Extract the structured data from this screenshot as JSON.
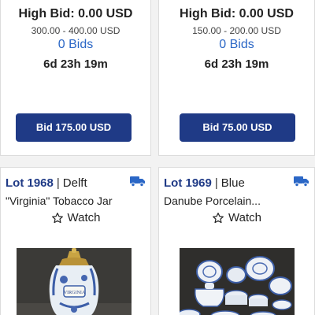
{
  "top_cards": [
    {
      "high_bid": "High Bid: 0.00 USD",
      "estimate": "300.00 - 400.00 USD",
      "bids": "0 Bids",
      "time_left": "6d 23h 19m",
      "bid_button": "Bid 175.00 USD"
    },
    {
      "high_bid": "High Bid: 0.00 USD",
      "estimate": "150.00 - 200.00 USD",
      "bids": "0 Bids",
      "time_left": "6d 23h 19m",
      "bid_button": "Bid 75.00 USD"
    }
  ],
  "lots": [
    {
      "lot_number": "Lot 1968",
      "separator": "|",
      "category": "Delft",
      "title": "\"Virginia\" Tobacco Jar",
      "watch_label": "Watch",
      "shipping_icon": "truck-icon",
      "photo_label": "VIRGINIA"
    },
    {
      "lot_number": "Lot 1969",
      "separator": "|",
      "category": "Blue",
      "title": "Danube Porcelain...",
      "watch_label": "Watch",
      "shipping_icon": "truck-icon"
    }
  ],
  "colors": {
    "accent_blue": "#1f3a86",
    "link_blue": "#2b67c6"
  }
}
